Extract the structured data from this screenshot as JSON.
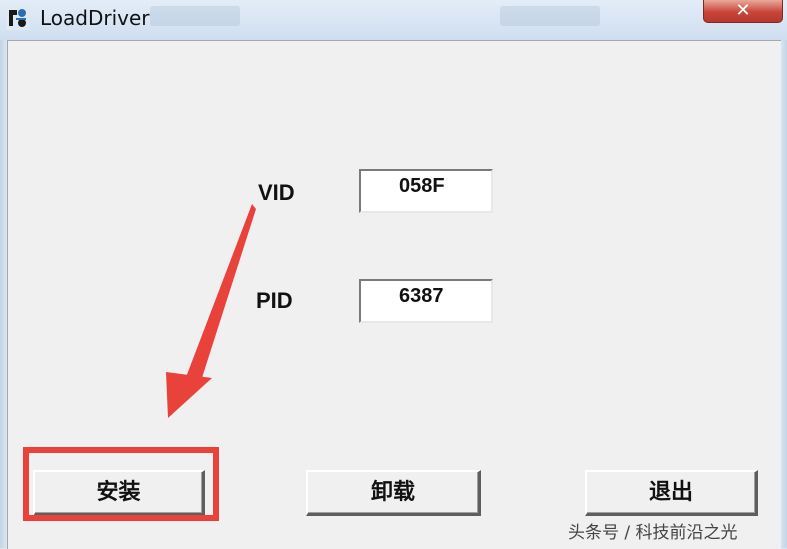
{
  "window": {
    "title": "LoadDriver",
    "close_label": "✕"
  },
  "form": {
    "vid_label": "VID",
    "vid_value": "058F",
    "pid_label": "PID",
    "pid_value": "6387"
  },
  "buttons": {
    "install_label": "安装",
    "uninstall_label": "卸载",
    "exit_label": "退出"
  },
  "watermark": "头条号 / 科技前沿之光",
  "colors": {
    "annotation": "#e8423a",
    "close": "#c8453a",
    "client_bg": "#f0f0f0"
  },
  "icons": {
    "app": "loaddriver-app-icon",
    "annotation_arrow": "red-arrow-icon"
  }
}
